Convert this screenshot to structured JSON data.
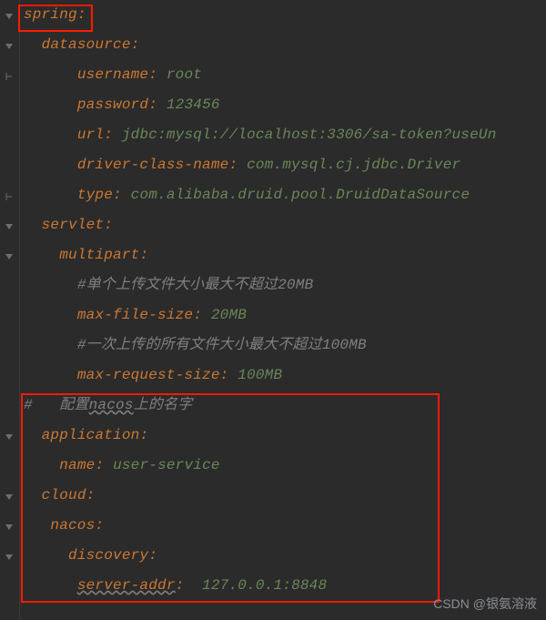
{
  "yaml": {
    "l0": {
      "key": "spring"
    },
    "l1": {
      "key": "datasource"
    },
    "l2": {
      "key": "username",
      "val": "root"
    },
    "l3": {
      "key": "password",
      "val": "123456"
    },
    "l4": {
      "key": "url",
      "val": "jdbc:mysql://localhost:3306/sa-token?useUn"
    },
    "l5": {
      "key": "driver-class-name",
      "val": "com.mysql.cj.jdbc.Driver"
    },
    "l6": {
      "key": "type",
      "val": "com.alibaba.druid.pool.DruidDataSource"
    },
    "l7": {
      "key": "servlet"
    },
    "l8": {
      "key": "multipart"
    },
    "l9": {
      "comment": "#单个上传文件大小最大不超过20MB"
    },
    "l10": {
      "key": "max-file-size",
      "val": "20MB"
    },
    "l11": {
      "comment": "#一次上传的所有文件大小最大不超过100MB"
    },
    "l12": {
      "key": "max-request-size",
      "val": "100MB"
    },
    "l13": {
      "comment_pre": "#",
      "comment_mid": "配置",
      "comment_sq": "nacos",
      "comment_post": "上的名字"
    },
    "l14": {
      "key": "application"
    },
    "l15": {
      "key": "name",
      "val": "user-service"
    },
    "l16": {
      "key": "cloud"
    },
    "l17": {
      "key": "nacos"
    },
    "l18": {
      "key": "discovery"
    },
    "l19": {
      "key": "server-addr",
      "val": "127.0.0.1:8848"
    }
  },
  "watermark": "CSDN @银氨溶液"
}
